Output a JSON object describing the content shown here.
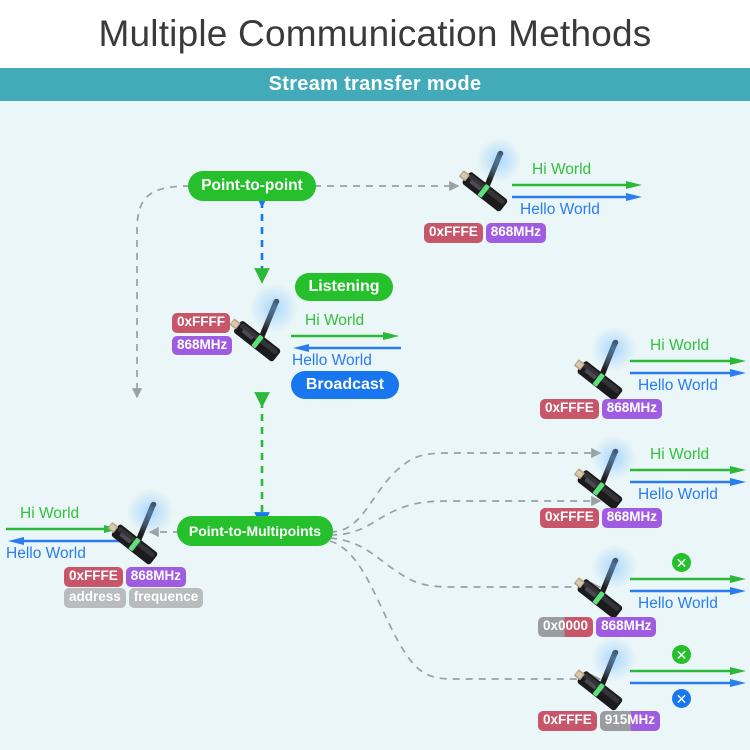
{
  "header": {
    "title": "Multiple Communication Methods",
    "subtitle": "Stream transfer mode",
    "bar_color": "#42aab8",
    "canvas_color": "#eaf6f7"
  },
  "nodes": {
    "point_to_point": "Point-to-point",
    "point_to_multipoints": "Point-to-Multipoints",
    "listening": "Listening",
    "broadcast": "Broadcast"
  },
  "messages": {
    "hi": "Hi World",
    "hello": "Hello World"
  },
  "legend": {
    "address": "address",
    "frequence": "frequence"
  },
  "icons": {
    "blocked": "✕"
  },
  "colors": {
    "green": "#25c02c",
    "blue": "#1877ef",
    "address_badge": "#c8566b",
    "frequency_badge": "#a05ce0",
    "disabled_badge": "#b9bcbe",
    "hi_text": "#34c13c",
    "hello_text": "#2a7df0"
  },
  "devices": [
    {
      "id": "master-center",
      "role": "central-transmitter",
      "address": "0xFFFF",
      "frequency": "868MHz",
      "tx_label": "Hi World",
      "rx_label": "Hello World",
      "tx_blocked": false,
      "rx_blocked": false
    },
    {
      "id": "p2p-peer",
      "role": "point-to-point-peer",
      "address": "0xFFFE",
      "frequency": "868MHz",
      "tx_label": "Hi World",
      "rx_label": "Hello World",
      "tx_blocked": false,
      "rx_blocked": false
    },
    {
      "id": "p2m-source",
      "role": "point-to-multipoints-source",
      "address": "0xFFFE",
      "frequency": "868MHz",
      "tx_label": "Hi World",
      "rx_label": "Hello World",
      "tx_blocked": false,
      "rx_blocked": false
    },
    {
      "id": "node-1",
      "role": "multipoint-node",
      "address": "0xFFFE",
      "frequency": "868MHz",
      "tx_label": "Hi World",
      "rx_label": "Hello World",
      "tx_blocked": false,
      "rx_blocked": false
    },
    {
      "id": "node-2",
      "role": "multipoint-node",
      "address": "0xFFFE",
      "frequency": "868MHz",
      "tx_label": "Hi World",
      "rx_label": "Hello World",
      "tx_blocked": false,
      "rx_blocked": false
    },
    {
      "id": "node-3",
      "role": "multipoint-node",
      "address": "0x0000",
      "address_prefix": "0x",
      "address_suffix": "0000",
      "frequency": "868MHz",
      "tx_label": "",
      "rx_label": "Hello World",
      "tx_blocked": true,
      "rx_blocked": false
    },
    {
      "id": "node-4",
      "role": "multipoint-node",
      "address": "0xFFFE",
      "frequency": "915MHz",
      "frequency_prefix": "915",
      "frequency_suffix": "MHz",
      "tx_label": "",
      "rx_label": "",
      "tx_blocked": true,
      "rx_blocked": true
    }
  ]
}
